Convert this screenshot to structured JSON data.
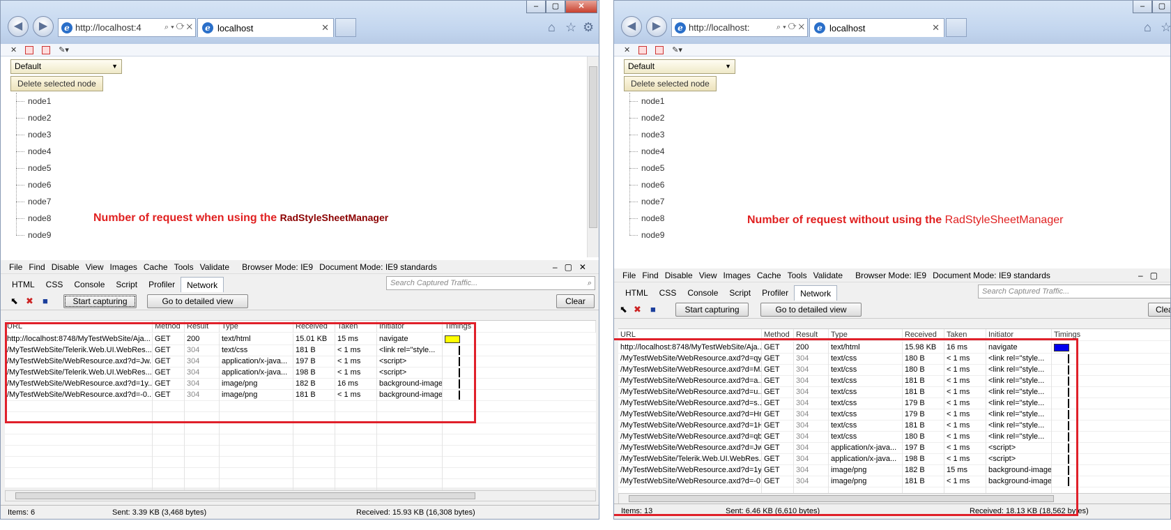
{
  "left": {
    "address": "http://localhost:4",
    "tab_title": "localhost",
    "dropdown_value": "Default",
    "delete_button": "Delete selected node",
    "nodes": [
      "node1",
      "node2",
      "node3",
      "node4",
      "node5",
      "node6",
      "node7",
      "node8",
      "node9"
    ],
    "annotation_prefix": "Number of request when using the ",
    "annotation_emph": "RadStyleSheetManager",
    "menu": [
      "File",
      "Find",
      "Disable",
      "View",
      "Images",
      "Cache",
      "Tools",
      "Validate"
    ],
    "browser_mode": "Browser Mode: IE9",
    "document_mode": "Document Mode: IE9 standards",
    "tabs": [
      "HTML",
      "CSS",
      "Console",
      "Script",
      "Profiler",
      "Network"
    ],
    "search_placeholder": "Search Captured Traffic...",
    "start_button": "Start capturing",
    "detail_button": "Go to detailed view",
    "clear_button": "Clear",
    "columns": [
      "URL",
      "Method",
      "Result",
      "Type",
      "Received",
      "Taken",
      "Initiator",
      "Timings"
    ],
    "rows": [
      [
        "http://localhost:8748/MyTestWebSite/Aja...",
        "GET",
        "200",
        "text/html",
        "15.01 KB",
        "15 ms",
        "navigate"
      ],
      [
        "/MyTestWebSite/Telerik.Web.UI.WebRes...",
        "GET",
        "304",
        "text/css",
        "181 B",
        "< 1 ms",
        "<link rel=\"style..."
      ],
      [
        "/MyTestWebSite/WebResource.axd?d=Jw...",
        "GET",
        "304",
        "application/x-java...",
        "197 B",
        "< 1 ms",
        "<script>"
      ],
      [
        "/MyTestWebSite/Telerik.Web.UI.WebRes...",
        "GET",
        "304",
        "application/x-java...",
        "198 B",
        "< 1 ms",
        "<script>"
      ],
      [
        "/MyTestWebSite/WebResource.axd?d=1y...",
        "GET",
        "304",
        "image/png",
        "182 B",
        "16 ms",
        "background-image"
      ],
      [
        "/MyTestWebSite/WebResource.axd?d=-0...",
        "GET",
        "304",
        "image/png",
        "181 B",
        "< 1 ms",
        "background-image"
      ]
    ],
    "items": "Items: 6",
    "sent": "Sent: 3.39 KB (3,468 bytes)",
    "received": "Received: 15.93 KB (16,308 bytes)"
  },
  "right": {
    "address": "http://localhost:",
    "tab_title": "localhost",
    "dropdown_value": "Default",
    "delete_button": "Delete selected node",
    "nodes": [
      "node1",
      "node2",
      "node3",
      "node4",
      "node5",
      "node6",
      "node7",
      "node8",
      "node9"
    ],
    "annotation_prefix": "Number of request without using the ",
    "annotation_emph": "RadStyleSheetManager",
    "menu": [
      "File",
      "Find",
      "Disable",
      "View",
      "Images",
      "Cache",
      "Tools",
      "Validate"
    ],
    "browser_mode": "Browser Mode: IE9",
    "document_mode": "Document Mode: IE9 standards",
    "tabs": [
      "HTML",
      "CSS",
      "Console",
      "Script",
      "Profiler",
      "Network"
    ],
    "search_placeholder": "Search Captured Traffic...",
    "start_button": "Start capturing",
    "detail_button": "Go to detailed view",
    "clear_button": "Clea",
    "columns": [
      "URL",
      "Method",
      "Result",
      "Type",
      "Received",
      "Taken",
      "Initiator",
      "Timings"
    ],
    "rows": [
      [
        "http://localhost:8748/MyTestWebSite/Aja...",
        "GET",
        "200",
        "text/html",
        "15.98 KB",
        "16 ms",
        "navigate"
      ],
      [
        "/MyTestWebSite/WebResource.axd?d=qy...",
        "GET",
        "304",
        "text/css",
        "180 B",
        "< 1 ms",
        "<link rel=\"style..."
      ],
      [
        "/MyTestWebSite/WebResource.axd?d=M...",
        "GET",
        "304",
        "text/css",
        "180 B",
        "< 1 ms",
        "<link rel=\"style..."
      ],
      [
        "/MyTestWebSite/WebResource.axd?d=a...",
        "GET",
        "304",
        "text/css",
        "181 B",
        "< 1 ms",
        "<link rel=\"style..."
      ],
      [
        "/MyTestWebSite/WebResource.axd?d=u...",
        "GET",
        "304",
        "text/css",
        "181 B",
        "< 1 ms",
        "<link rel=\"style..."
      ],
      [
        "/MyTestWebSite/WebResource.axd?d=s...",
        "GET",
        "304",
        "text/css",
        "179 B",
        "< 1 ms",
        "<link rel=\"style..."
      ],
      [
        "/MyTestWebSite/WebResource.axd?d=Hn...",
        "GET",
        "304",
        "text/css",
        "179 B",
        "< 1 ms",
        "<link rel=\"style..."
      ],
      [
        "/MyTestWebSite/WebResource.axd?d=1H...",
        "GET",
        "304",
        "text/css",
        "181 B",
        "< 1 ms",
        "<link rel=\"style..."
      ],
      [
        "/MyTestWebSite/WebResource.axd?d=qb...",
        "GET",
        "304",
        "text/css",
        "180 B",
        "< 1 ms",
        "<link rel=\"style..."
      ],
      [
        "/MyTestWebSite/WebResource.axd?d=Jw...",
        "GET",
        "304",
        "application/x-java...",
        "197 B",
        "< 1 ms",
        "<script>"
      ],
      [
        "/MyTestWebSite/Telerik.Web.UI.WebRes...",
        "GET",
        "304",
        "application/x-java...",
        "198 B",
        "< 1 ms",
        "<script>"
      ],
      [
        "/MyTestWebSite/WebResource.axd?d=1y...",
        "GET",
        "304",
        "image/png",
        "182 B",
        "15 ms",
        "background-image"
      ],
      [
        "/MyTestWebSite/WebResource.axd?d=-0...",
        "GET",
        "304",
        "image/png",
        "181 B",
        "< 1 ms",
        "background-image"
      ]
    ],
    "items": "Items: 13",
    "sent": "Sent: 6.46 KB (6,610 bytes)",
    "received": "Received: 18.13 KB (18,562 bytes)"
  },
  "colors": {
    "annotation_red": "#e02020",
    "highlight_box": "#e0202a",
    "timing_first_left": "#ffff00",
    "timing_first_right": "#0000ee"
  }
}
